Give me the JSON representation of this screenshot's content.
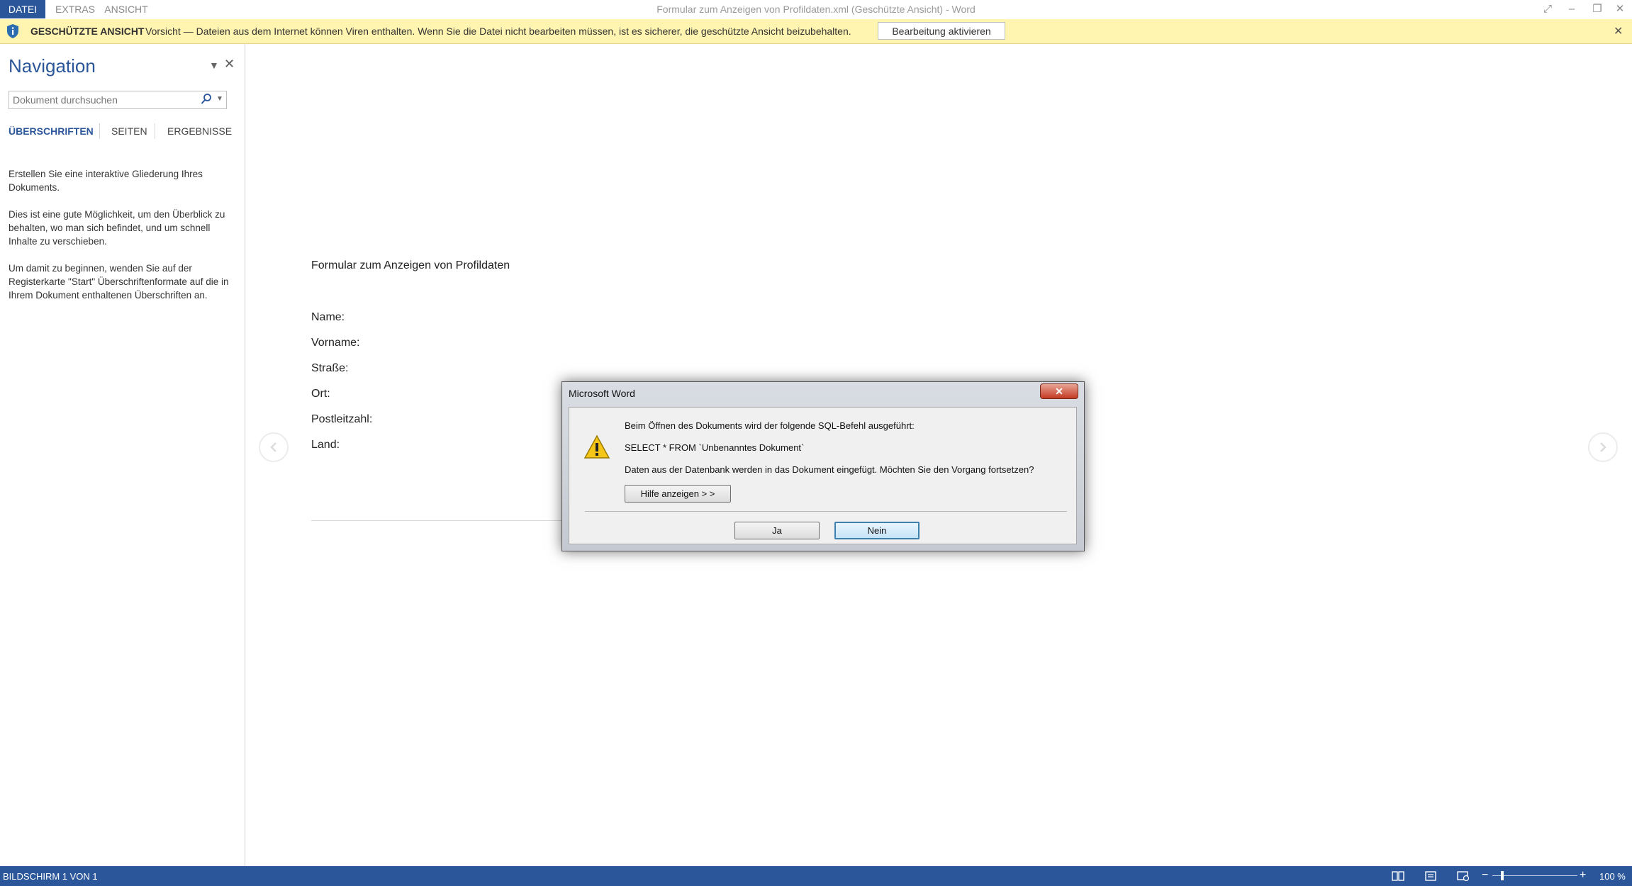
{
  "window": {
    "title": "Formular zum Anzeigen von Profildaten.xml (Geschützte Ansicht) - Word",
    "menu_tabs": [
      "DATEI",
      "EXTRAS",
      "ANSICHT"
    ]
  },
  "protected_bar": {
    "title": "GESCHÜTZTE ANSICHT",
    "message": "Vorsicht — Dateien aus dem Internet können Viren enthalten. Wenn Sie die Datei nicht bearbeiten müssen, ist es sicherer, die geschützte Ansicht beizubehalten.",
    "button": "Bearbeitung aktivieren"
  },
  "navigation": {
    "title": "Navigation",
    "search_placeholder": "Dokument durchsuchen",
    "tabs": [
      "ÜBERSCHRIFTEN",
      "SEITEN",
      "ERGEBNISSE"
    ],
    "paragraphs": [
      "Erstellen Sie eine interaktive Gliederung Ihres Dokuments.",
      "Dies ist eine gute Möglichkeit, um den Überblick zu behalten, wo man sich befindet, und um schnell Inhalte zu verschieben.",
      "Um damit zu beginnen, wenden Sie auf der Registerkarte \"Start\" Überschriftenformate auf die in Ihrem Dokument enthaltenen Überschriften an."
    ]
  },
  "document": {
    "title": "Formular zum Anzeigen von Profildaten",
    "fields": [
      "Name:",
      "Vorname:",
      "Straße:",
      "Ort:",
      "Postleitzahl:",
      "Land:"
    ]
  },
  "dialog": {
    "title": "Microsoft Word",
    "line1": "Beim Öffnen des Dokuments wird der folgende SQL-Befehl ausgeführt:",
    "line2": "SELECT * FROM `Unbenanntes Dokument`",
    "line3": "Daten aus der Datenbank werden in das Dokument eingefügt. Möchten Sie den Vorgang fortsetzen?",
    "help_button": "Hilfe anzeigen > >",
    "yes_button": "Ja",
    "no_button": "Nein"
  },
  "status": {
    "page_info": "BILDSCHIRM 1 VON 1",
    "zoom": "100 %",
    "zoom_fraction": 0.1
  },
  "colors": {
    "accent": "#2b579a",
    "warning_bar": "#fff4b0"
  }
}
